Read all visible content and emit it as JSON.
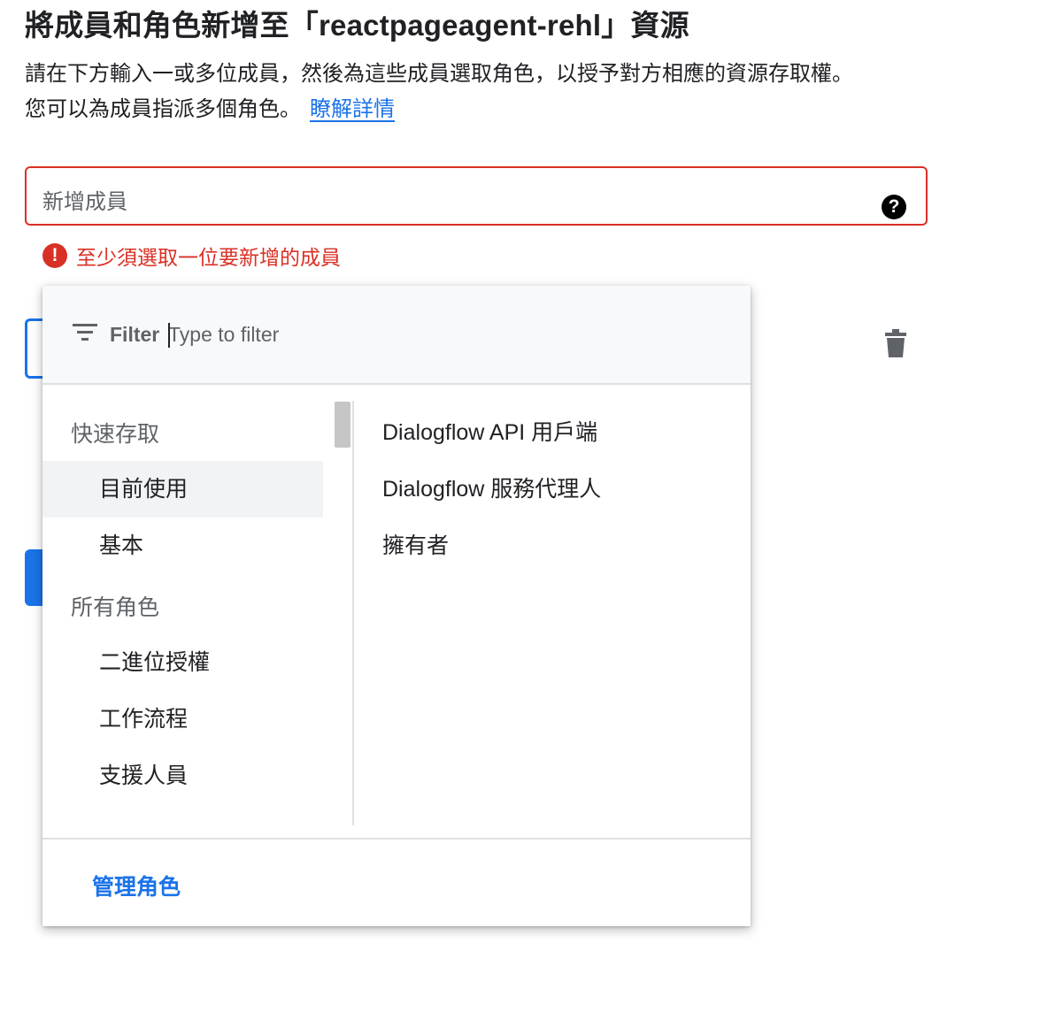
{
  "header": {
    "title": "將成員和角色新增至「reactpageagent-rehl」資源",
    "description_line1": "請在下方輸入一或多位成員，然後為這些成員選取角色，以授予對方相應的資源存取權。",
    "description_line2": "您可以為成員指派多個角色。",
    "learn_more_link": "瞭解詳情"
  },
  "member_field": {
    "placeholder": "新增成員",
    "help_icon": "question-circle-icon",
    "error_icon": "error-icon",
    "error_message": "至少須選取一位要新增的成員"
  },
  "role_picker": {
    "filter_label": "Filter",
    "filter_placeholder": "Type to filter",
    "filter_icon": "filter-icon",
    "categories": [
      {
        "label": "快速存取",
        "items": [
          "目前使用",
          "基本"
        ]
      },
      {
        "label": "所有角色",
        "items": [
          "二進位授權",
          "工作流程",
          "支援人員"
        ]
      }
    ],
    "selected_item": "目前使用",
    "roles": [
      "Dialogflow API 用戶端",
      "Dialogflow 服務代理人",
      "擁有者"
    ],
    "manage_roles": "管理角色"
  },
  "delete_icon": "trash-icon",
  "colors": {
    "link": "#1a73e8",
    "error": "#d93025",
    "selected_bg": "#f1f3f4"
  }
}
